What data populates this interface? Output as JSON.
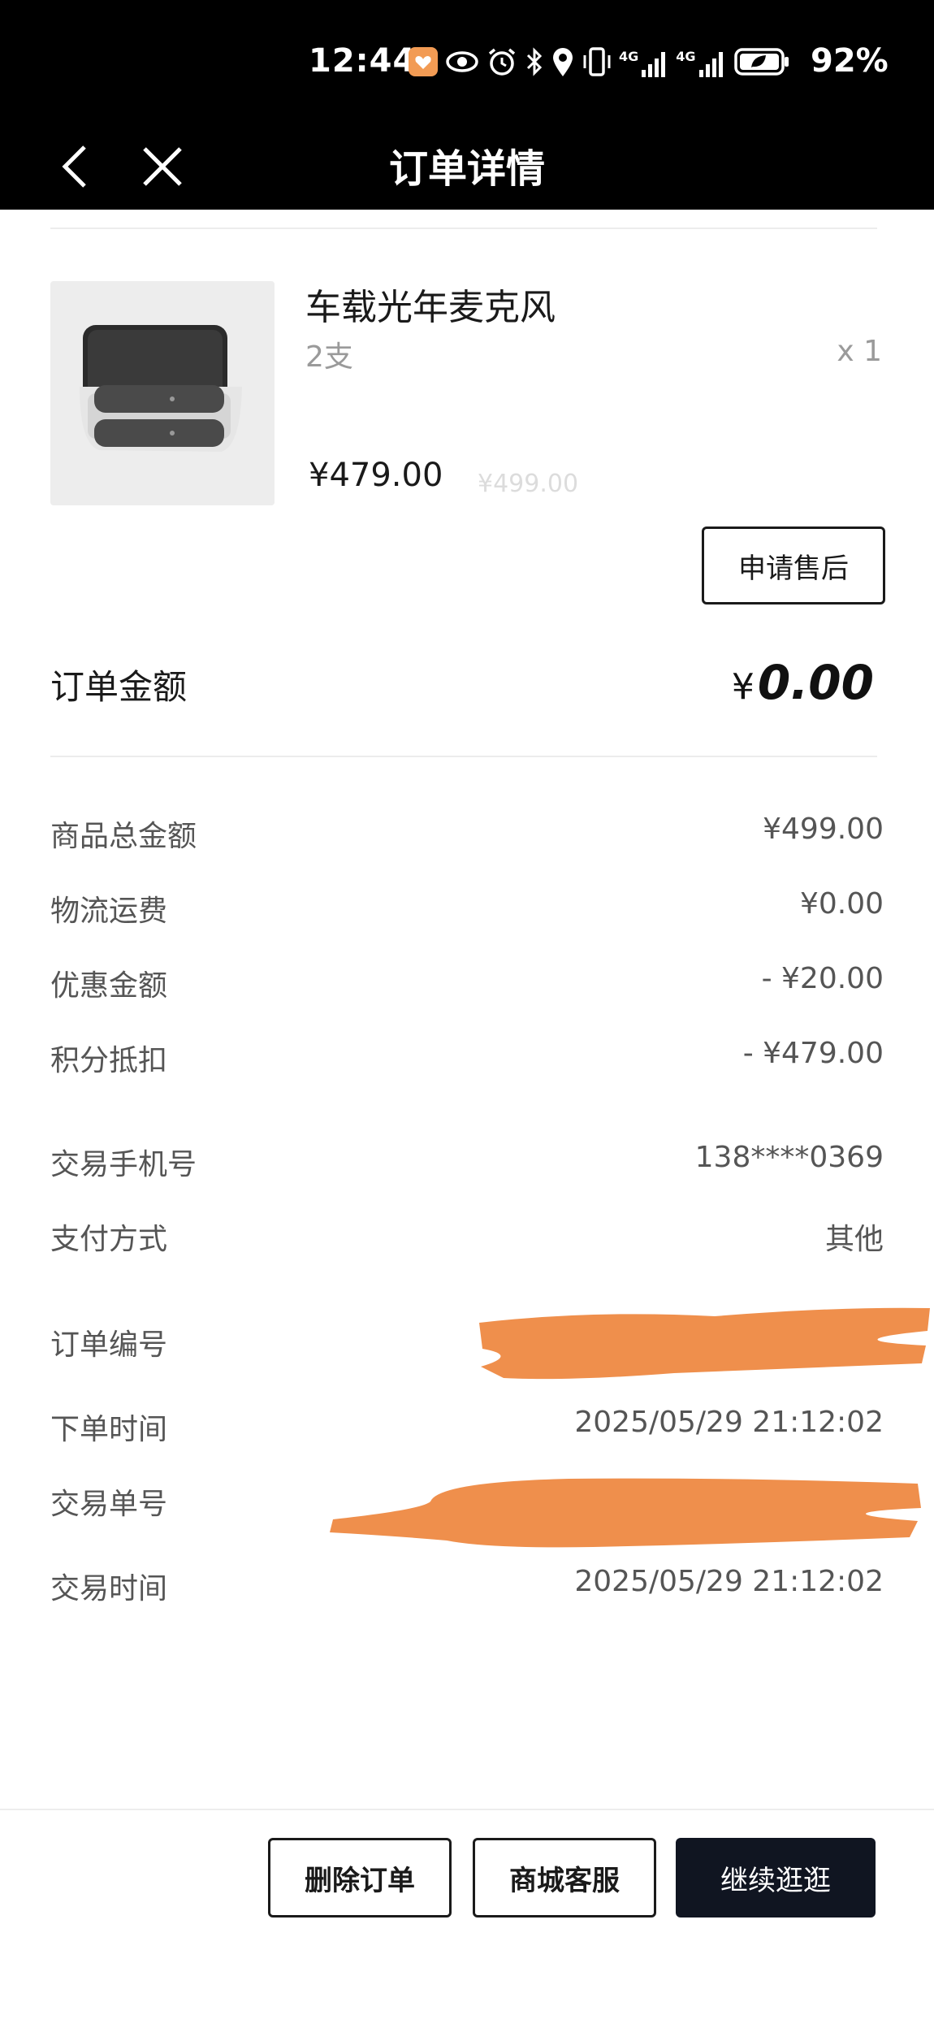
{
  "status_bar": {
    "time": "12:44",
    "battery": "92%",
    "network_1": "4G",
    "network_2": "4G",
    "icons": [
      "app-notification-icon",
      "eye-icon",
      "alarm-icon",
      "bluetooth-icon",
      "location-icon",
      "vibrate-icon",
      "signal-icon",
      "signal-icon",
      "battery-icon"
    ]
  },
  "nav": {
    "title": "订单详情"
  },
  "product": {
    "name": "车载光年麦克风",
    "spec": "2支",
    "quantity": "x 1",
    "price": "¥479.00",
    "original_price": "¥499.00",
    "after_sale_button": "申请售后"
  },
  "order_total": {
    "label": "订单金额",
    "currency": "¥",
    "amount": "0.00"
  },
  "fees": [
    {
      "label": "商品总金额",
      "value": "¥499.00"
    },
    {
      "label": "物流运费",
      "value": "¥0.00"
    },
    {
      "label": "优惠金额",
      "value": "- ¥20.00"
    },
    {
      "label": "积分抵扣",
      "value": "- ¥479.00"
    }
  ],
  "info": [
    {
      "label": "交易手机号",
      "value": "138****0369"
    },
    {
      "label": "支付方式",
      "value": "其他"
    },
    {
      "label": "订单编号",
      "value": ""
    },
    {
      "label": "下单时间",
      "value": "2025/05/29 21:12:02"
    },
    {
      "label": "交易单号",
      "value": ""
    },
    {
      "label": "交易时间",
      "value": "2025/05/29 21:12:02"
    }
  ],
  "bottom_bar": {
    "delete_button": "删除订单",
    "service_button": "商城客服",
    "continue_button": "继续逛逛"
  },
  "colors": {
    "header_bg": "#000000",
    "redaction": "#ef8f4c",
    "primary_button": "#101521"
  }
}
